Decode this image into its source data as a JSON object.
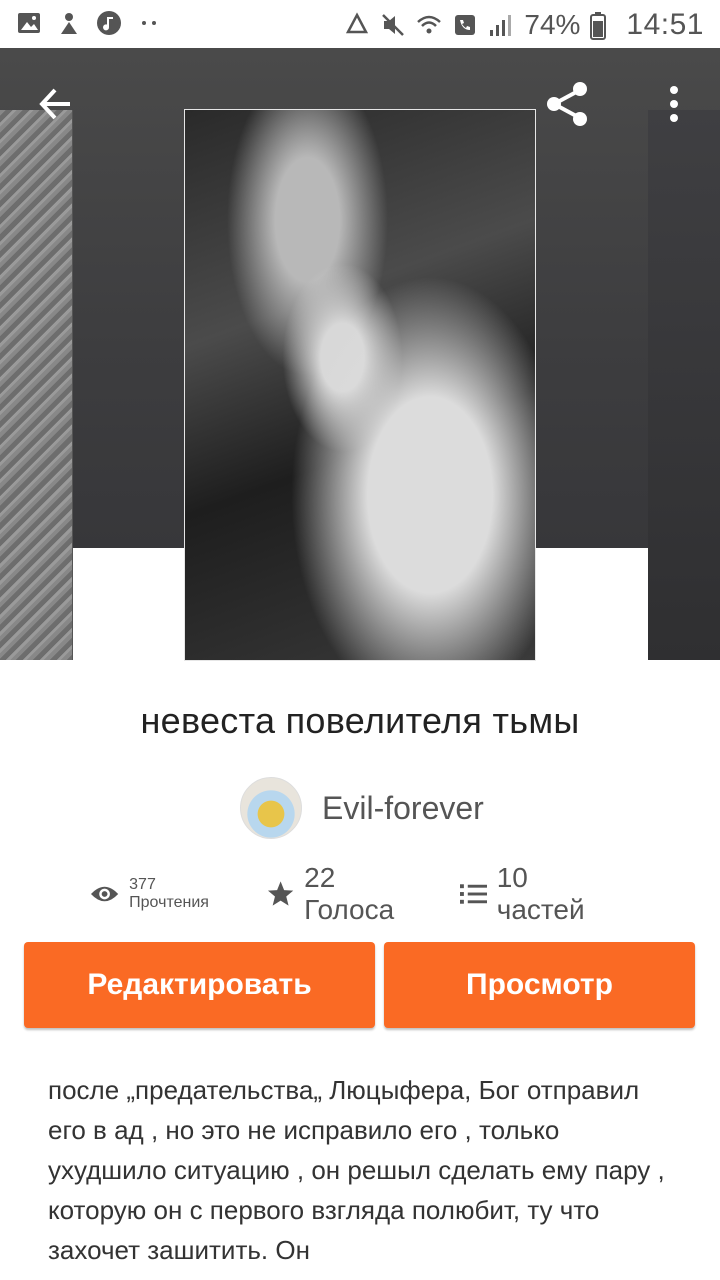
{
  "status_bar": {
    "battery_percent": "74%",
    "time": "14:51",
    "left_icons": [
      "image-icon",
      "gift-icon",
      "music-icon",
      "dots-icon"
    ],
    "right_icons": [
      "recycle-icon",
      "mute-icon",
      "wifi-call-icon",
      "phone-icon",
      "signal-icon",
      "battery-icon"
    ]
  },
  "header": {
    "back_icon": "arrow-left-icon",
    "share_icon": "share-icon",
    "more_icon": "more-vertical-icon"
  },
  "story": {
    "title": "невеста повелителя тьмы",
    "author": "Evil-forever",
    "stats": {
      "reads": "377 Прочтения",
      "votes": "22 Голоса",
      "parts": "10 частей"
    },
    "description": "после „предательства„ Люцыфера, Бог отправил его в ад , но это не исправило его , только ухудшило ситуацию , он решыл сделать ему пару , которую он с первого взгляда полюбит, ту что захочет зашитить. Он"
  },
  "actions": {
    "edit_label": "Редактировать",
    "view_label": "Просмотр"
  },
  "colors": {
    "accent": "#fa6a24",
    "hero_bg": "#3d3d3f",
    "text": "#222222"
  }
}
